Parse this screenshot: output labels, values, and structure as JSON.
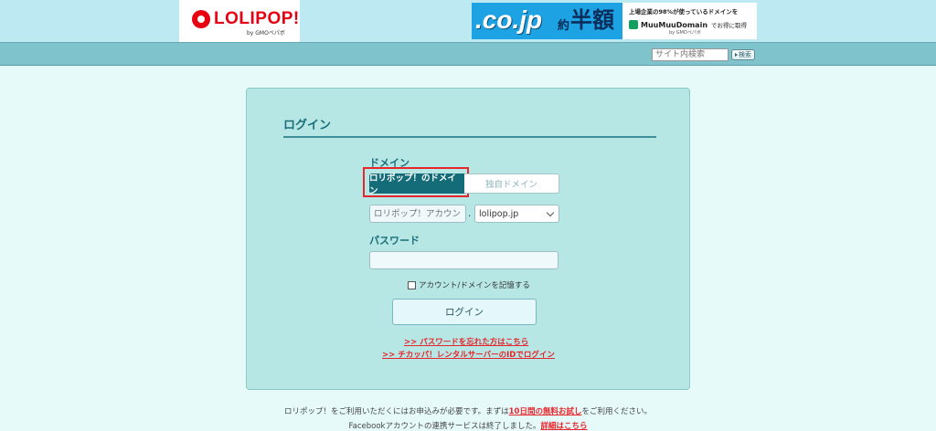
{
  "header": {
    "logo": {
      "text": "LOLIPOP!",
      "sub": "by GMOペパボ",
      "brand_color": "#e60012"
    },
    "banner": {
      "cojp": ".co.jp",
      "yaku": "約",
      "hangaku": "半額",
      "line1": "上場企業の98%が使っているドメインを",
      "mm_name": "MuuMuuDomain",
      "mm_note": "でお得に取得",
      "gmo": "by GMOペパボ"
    },
    "search": {
      "placeholder": "サイト内検索",
      "button_label": "検索"
    }
  },
  "login": {
    "title": "ログイン",
    "domain_label": "ドメイン",
    "tabs": [
      {
        "label": "ロリポップ！のドメイン",
        "active": true
      },
      {
        "label": "独自ドメイン",
        "active": false
      }
    ],
    "account_placeholder": "ロリポップ！アカウント",
    "separator": ".",
    "domain_select_value": "lolipop.jp",
    "password_label": "パスワード",
    "remember_label": "アカウント/ドメインを記憶する",
    "submit_label": "ログイン",
    "links": [
      ">> パスワードを忘れた方はこちら",
      ">> チカッパ！レンタルサーバーのIDでログイン"
    ],
    "accent_color": "#136c78",
    "link_color": "#e5262c"
  },
  "footer": {
    "line1_before": "ロリポップ！をご利用いただくにはお申込みが必要です。まずは",
    "line1_link": "10日間の無料お試し",
    "line1_after": "をご利用ください。",
    "line2_before": "Facebookアカウントの連携サービスは終了しました。",
    "line2_link": "詳細はこちら"
  }
}
